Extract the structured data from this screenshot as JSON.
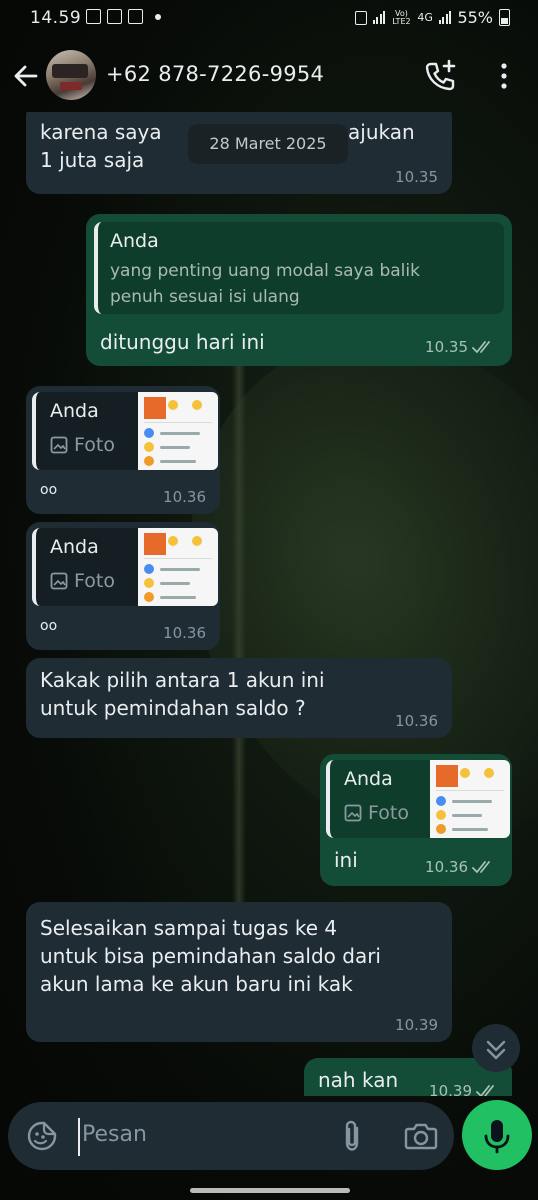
{
  "status": {
    "time": "14.59",
    "network": "4G",
    "lte_label": "Vo) LTE2",
    "battery": "55%"
  },
  "header": {
    "contact": "+62 878-7226-9954"
  },
  "chat": {
    "date_divider": "28 Maret 2025",
    "messages": [
      {
        "direction": "in",
        "text": "karena saya [...]ajukan\n1 juta saja",
        "text_left": "karena saya ",
        "text_right": "ajukan",
        "line2": "1 juta saja",
        "time": "10.35"
      },
      {
        "direction": "out",
        "quote_name": "Anda",
        "quote_text": "yang penting uang modal saya balik\npenuh sesuai isi ulang",
        "text": "ditunggu hari ini",
        "time": "10.35"
      },
      {
        "direction": "in",
        "quote_name": "Anda",
        "quote_type": "Foto",
        "text": "oo",
        "time": "10.36"
      },
      {
        "direction": "in",
        "quote_name": "Anda",
        "quote_type": "Foto",
        "text": "oo",
        "time": "10.36"
      },
      {
        "direction": "in",
        "text": "Kakak pilih antara 1 akun ini\nuntuk pemindahan saldo ?",
        "time": "10.36"
      },
      {
        "direction": "out",
        "quote_name": "Anda",
        "quote_type": "Foto",
        "text": "ini",
        "time": "10.36"
      },
      {
        "direction": "in",
        "text": "Selesaikan sampai tugas ke 4\nuntuk bisa pemindahan saldo dari\nakun lama ke akun baru ini kak",
        "time": "10.39"
      },
      {
        "direction": "out",
        "text": "nah kan",
        "time": "10.39"
      }
    ]
  },
  "composer": {
    "placeholder": "Pesan"
  },
  "colors": {
    "incoming_bubble": "#1f2c33",
    "outgoing_bubble": "#144d37",
    "mic_button": "#21c063"
  },
  "icons": [
    "back-arrow-icon",
    "add-call-icon",
    "more-vert-icon",
    "emoji-sticker-icon",
    "attach-icon",
    "camera-icon",
    "mic-icon",
    "scroll-down-icon",
    "photo-icon",
    "double-check-icon"
  ]
}
